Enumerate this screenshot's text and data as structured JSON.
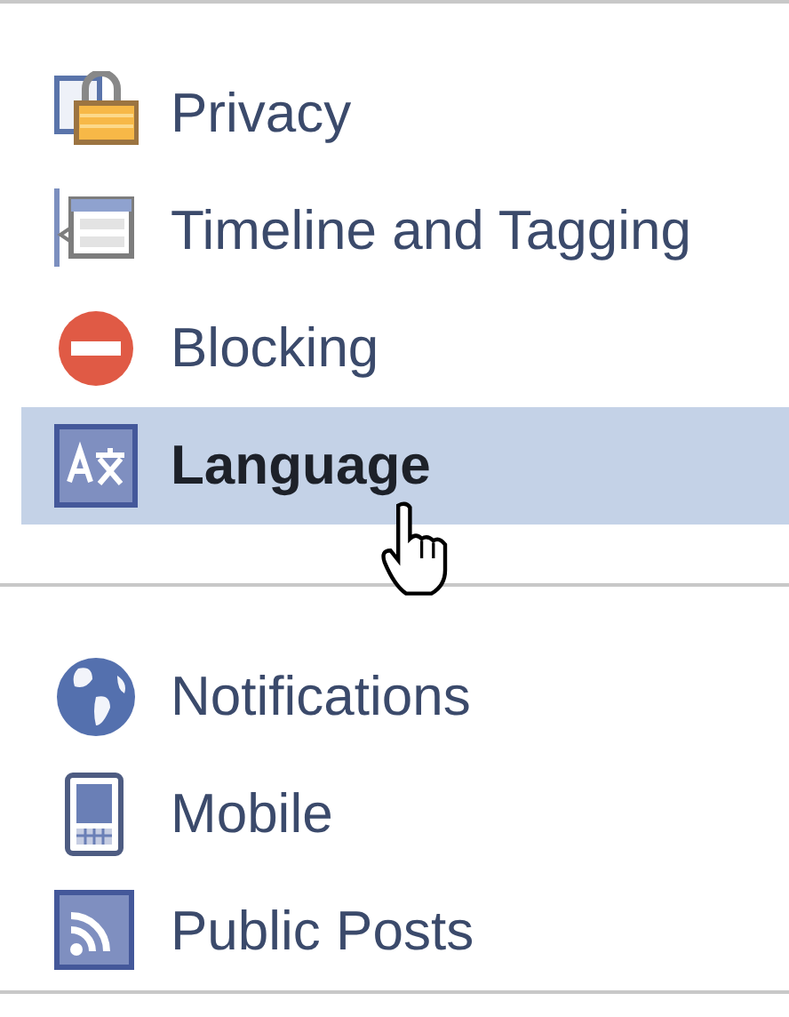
{
  "sections": [
    {
      "items": [
        {
          "label": "Privacy",
          "kind": "lock",
          "selected": false
        },
        {
          "label": "Timeline and Tagging",
          "kind": "timeline",
          "selected": false
        },
        {
          "label": "Blocking",
          "kind": "block",
          "selected": false
        },
        {
          "label": "Language",
          "kind": "language",
          "selected": true
        }
      ]
    },
    {
      "items": [
        {
          "label": "Notifications",
          "kind": "globe",
          "selected": false
        },
        {
          "label": "Mobile",
          "kind": "phone",
          "selected": false
        },
        {
          "label": "Public Posts",
          "kind": "feed",
          "selected": false
        }
      ]
    }
  ]
}
